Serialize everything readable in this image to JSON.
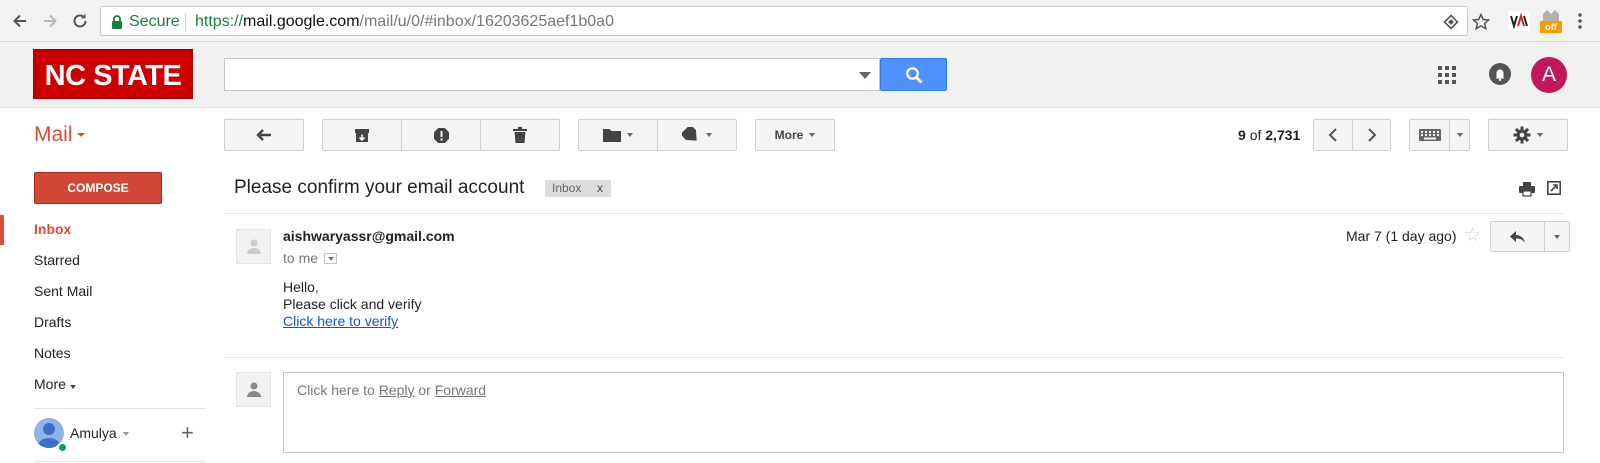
{
  "browser": {
    "secure_label": "Secure",
    "url_scheme": "https://",
    "url_host": "mail.google.com",
    "url_path": "/mail/u/0/#inbox/16203625aef1b0a0",
    "extension_badge": "off"
  },
  "header": {
    "logo_text": "NC STATE",
    "search_value": "",
    "avatar_initial": "A"
  },
  "toolbar": {
    "mail_label": "Mail",
    "more_label": "More",
    "count_current": "9",
    "count_of": "of",
    "count_total": "2,731"
  },
  "sidebar": {
    "compose_label": "COMPOSE",
    "items": [
      {
        "label": "Inbox"
      },
      {
        "label": "Starred"
      },
      {
        "label": "Sent Mail"
      },
      {
        "label": "Drafts"
      },
      {
        "label": "Notes"
      },
      {
        "label": "More"
      }
    ],
    "user_name": "Amulya"
  },
  "message": {
    "subject": "Please confirm your email account",
    "label": "Inbox",
    "label_remove": "x",
    "sender": "aishwaryassr@gmail.com",
    "to": "to me",
    "date": "Mar 7 (1 day ago)",
    "body_line1": "Hello,",
    "body_line2": "Please click and verify",
    "link_text": "Click here to verify"
  },
  "reply": {
    "prefix": "Click here to",
    "reply_link": "Reply",
    "or": "or",
    "forward_link": "Forward"
  },
  "colors": {
    "logo_red": "#cc0000",
    "gmail_red": "#dd4b39",
    "search_blue": "#4d90fe",
    "link_blue": "#1155cc",
    "avatar_pink": "#c2185b"
  }
}
